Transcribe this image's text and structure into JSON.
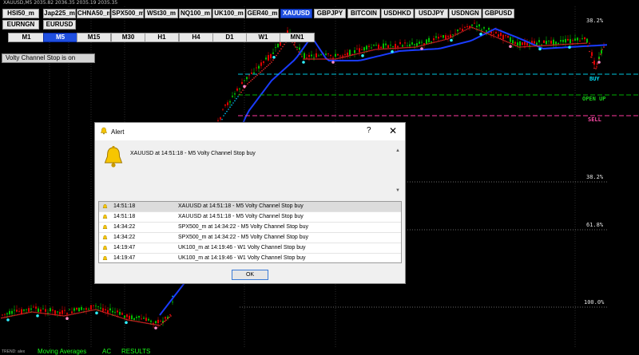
{
  "window": {
    "title": "XAUUSD,M5  2035.82 2036.35 2035.19 2035.35"
  },
  "symbols": [
    "HSI50_m",
    "Jap225_m",
    "CHNA50_m",
    "SPX500_m",
    "WSt30_m",
    "NQ100_m",
    "UK100_m",
    "GER40_m",
    "XAUUSD",
    "GBPJPY",
    "BITCOIN",
    "USDHKD",
    "USDJPY",
    "USDNGN",
    "GBPUSD",
    "EURNGN",
    "EURUSD"
  ],
  "active_symbol": "XAUUSD",
  "timeframes": [
    "M1",
    "M5",
    "M15",
    "M30",
    "H1",
    "H4",
    "D1",
    "W1",
    "MN1"
  ],
  "active_timeframe": "M5",
  "status_label": "Volty Channel Stop is on",
  "levels": {
    "buy": "BUY",
    "open_up": "OPEN UP",
    "sell": "SELL"
  },
  "fib": {
    "top": "38.2%",
    "mid": "38.2%",
    "f618": "61.8%",
    "f100": "100.0%"
  },
  "tabs": {
    "trend": "TREND: alex",
    "moving_averages": "Moving Averages",
    "ac": "AC",
    "results": "RESULTS"
  },
  "colors": {
    "up_bar": "#00c000",
    "down_bar": "#e00000",
    "ma_blue": "#1a3cff",
    "signal_red": "#ff2a2a",
    "buy_line": "#00c8e0",
    "openup_line": "#00b000",
    "sell_line": "#ff3aa0",
    "active_button": "#1f4fe0"
  },
  "alert": {
    "title": "Alert",
    "help": "?",
    "close": "✕",
    "message": "XAUUSD at 14:51:18 - M5 Volty Channel Stop buy",
    "rows": [
      {
        "time": "14:51:18",
        "text": "XAUUSD at 14:51:18 - M5 Volty Channel Stop buy"
      },
      {
        "time": "14:51:18",
        "text": "XAUUSD at 14:51:18 - M5 Volty Channel Stop buy"
      },
      {
        "time": "14:34:22",
        "text": "SPX500_m at 14:34:22 - M5 Volty Channel Stop buy"
      },
      {
        "time": "14:34:22",
        "text": "SPX500_m at 14:34:22 - M5 Volty Channel Stop buy"
      },
      {
        "time": "14:19:47",
        "text": "UK100_m at 14:19:46 - W1 Volty Channel Stop buy"
      },
      {
        "time": "14:19:47",
        "text": "UK100_m at 14:19:46 - W1 Volty Channel Stop buy"
      }
    ],
    "ok": "OK"
  }
}
